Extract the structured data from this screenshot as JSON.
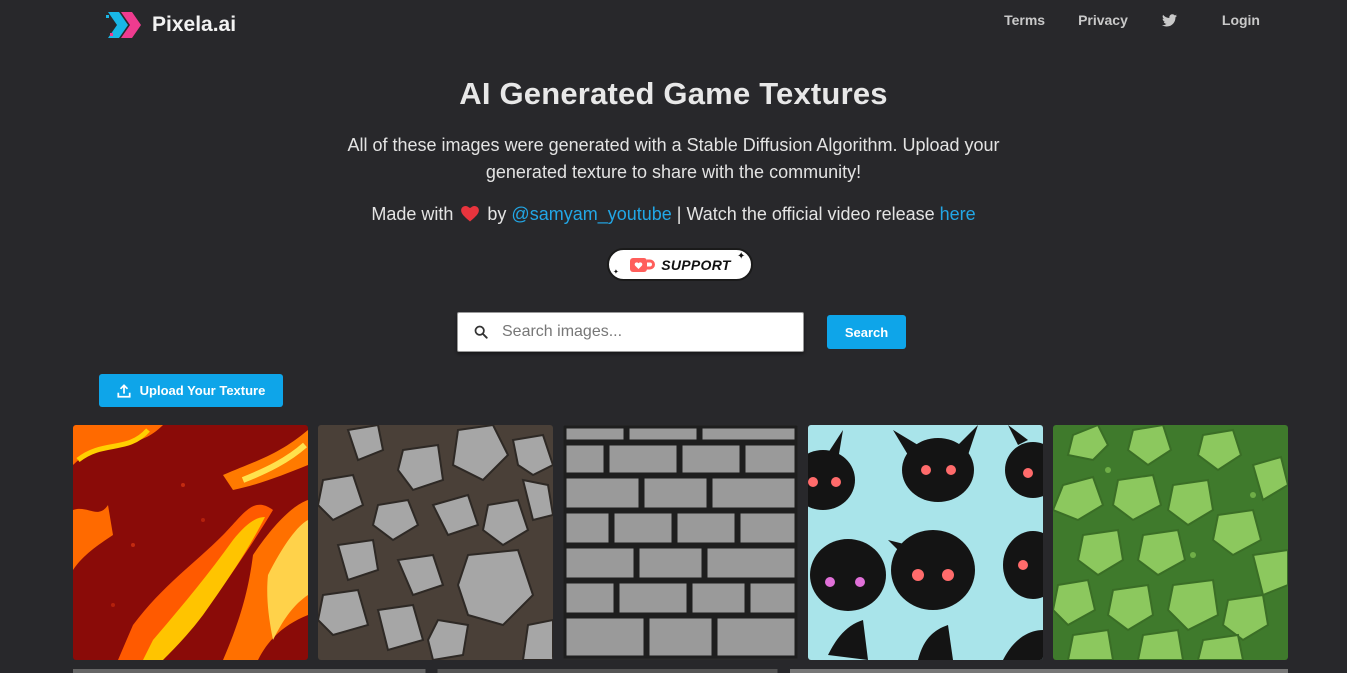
{
  "nav": {
    "brand": "Pixela.ai",
    "links": [
      {
        "label": "Terms"
      },
      {
        "label": "Privacy"
      },
      {
        "label": "Login"
      }
    ]
  },
  "hero": {
    "title": "AI Generated Game Textures",
    "description": "All of these images were generated with a Stable Diffusion Algorithm. Upload your generated texture to share with the community!",
    "made_with_prefix": "Made with",
    "made_with_by": "by",
    "author_link": "@samyam_youtube",
    "separator": "| Watch the official video release",
    "video_link": "here"
  },
  "support": {
    "label": "SUPPORT"
  },
  "search": {
    "placeholder": "Search images...",
    "button_label": "Search"
  },
  "upload": {
    "label": "Upload Your Texture"
  },
  "textures": [
    {
      "icon": "lava-texture"
    },
    {
      "icon": "stone-texture"
    },
    {
      "icon": "brick-texture"
    },
    {
      "icon": "creature-texture"
    },
    {
      "icon": "leaf-texture"
    }
  ],
  "colors": {
    "background": "#28282b",
    "accent": "#0ea5e9",
    "link": "#22a7e6",
    "heart": "#e8343d"
  }
}
